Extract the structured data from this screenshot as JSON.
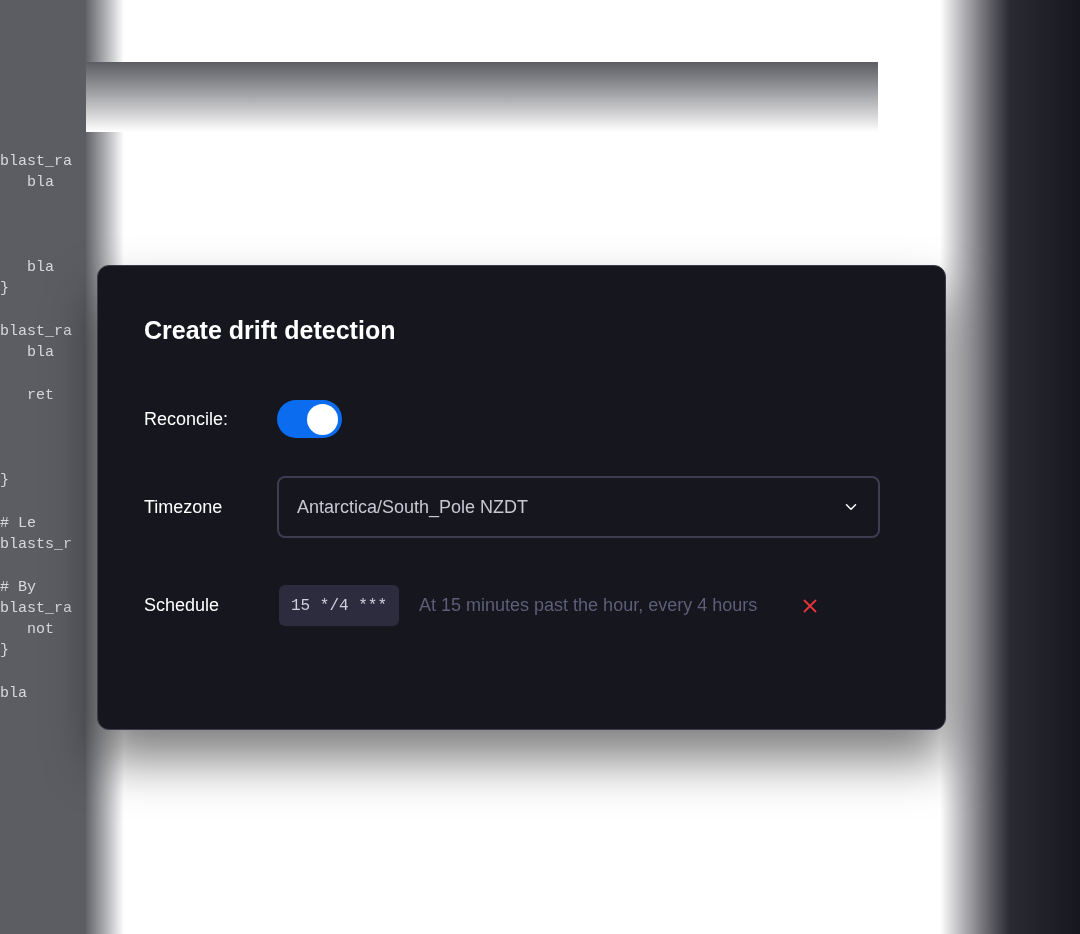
{
  "background_code": "\n\nblast_ra\n   bla\n\n\n\n   bla\n}\n\nblast_ra\n   bla\n\n   ret\n\n\n\n}\n\n# Le\nblasts_r\n\n# By\nblast_ra\n   not\n}\n\nbla",
  "dialog": {
    "title": "Create drift detection",
    "reconcile": {
      "label": "Reconcile:",
      "on": true
    },
    "timezone": {
      "label": "Timezone",
      "value": "Antarctica/South_Pole NZDT"
    },
    "schedule": {
      "label": "Schedule",
      "expression": "15 */4 ***",
      "description": "At 15 minutes past the hour, every 4 hours"
    }
  }
}
